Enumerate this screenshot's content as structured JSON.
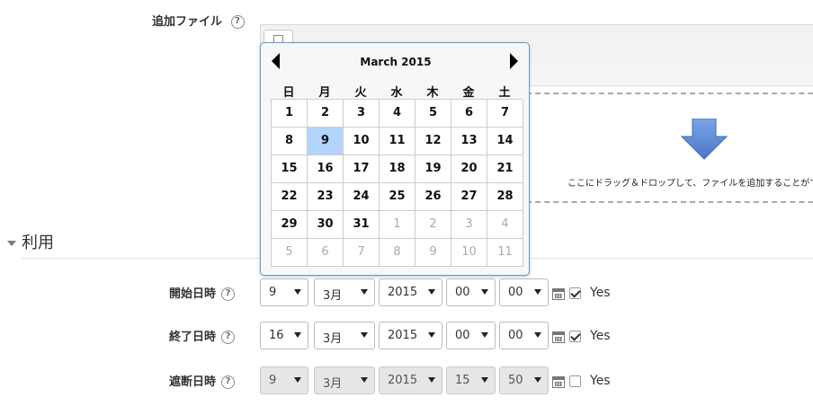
{
  "attachments": {
    "label": "追加ファイル",
    "help": "?"
  },
  "dropzone": {
    "text": "ここにドラッグ＆ドロップして、ファイルを追加することができ"
  },
  "availability": {
    "section_title": "利用"
  },
  "rows": [
    {
      "label": "開始日時",
      "help": "?",
      "day": "9",
      "month": "3月",
      "year": "2015",
      "hour": "00",
      "minute": "00",
      "enabled": true,
      "disabled": false,
      "yes_label": "Yes"
    },
    {
      "label": "終了日時",
      "help": "?",
      "day": "16",
      "month": "3月",
      "year": "2015",
      "hour": "00",
      "minute": "00",
      "enabled": true,
      "disabled": false,
      "yes_label": "Yes"
    },
    {
      "label": "遮断日時",
      "help": "?",
      "day": "9",
      "month": "3月",
      "year": "2015",
      "hour": "15",
      "minute": "50",
      "enabled": false,
      "disabled": true,
      "yes_label": "Yes"
    }
  ],
  "calendar": {
    "title": "March 2015",
    "weekdays": [
      "日",
      "月",
      "火",
      "水",
      "木",
      "金",
      "土"
    ],
    "selected_day": "9",
    "weeks": [
      [
        {
          "d": "1",
          "cur": true
        },
        {
          "d": "2",
          "cur": true
        },
        {
          "d": "3",
          "cur": true
        },
        {
          "d": "4",
          "cur": true
        },
        {
          "d": "5",
          "cur": true
        },
        {
          "d": "6",
          "cur": true
        },
        {
          "d": "7",
          "cur": true
        }
      ],
      [
        {
          "d": "8",
          "cur": true
        },
        {
          "d": "9",
          "cur": true
        },
        {
          "d": "10",
          "cur": true
        },
        {
          "d": "11",
          "cur": true
        },
        {
          "d": "12",
          "cur": true
        },
        {
          "d": "13",
          "cur": true
        },
        {
          "d": "14",
          "cur": true
        }
      ],
      [
        {
          "d": "15",
          "cur": true
        },
        {
          "d": "16",
          "cur": true
        },
        {
          "d": "17",
          "cur": true
        },
        {
          "d": "18",
          "cur": true
        },
        {
          "d": "19",
          "cur": true
        },
        {
          "d": "20",
          "cur": true
        },
        {
          "d": "21",
          "cur": true
        }
      ],
      [
        {
          "d": "22",
          "cur": true
        },
        {
          "d": "23",
          "cur": true
        },
        {
          "d": "24",
          "cur": true
        },
        {
          "d": "25",
          "cur": true
        },
        {
          "d": "26",
          "cur": true
        },
        {
          "d": "27",
          "cur": true
        },
        {
          "d": "28",
          "cur": true
        }
      ],
      [
        {
          "d": "29",
          "cur": true
        },
        {
          "d": "30",
          "cur": true
        },
        {
          "d": "31",
          "cur": true
        },
        {
          "d": "1",
          "cur": false
        },
        {
          "d": "2",
          "cur": false
        },
        {
          "d": "3",
          "cur": false
        },
        {
          "d": "4",
          "cur": false
        }
      ],
      [
        {
          "d": "5",
          "cur": false
        },
        {
          "d": "6",
          "cur": false
        },
        {
          "d": "7",
          "cur": false
        },
        {
          "d": "8",
          "cur": false
        },
        {
          "d": "9",
          "cur": false
        },
        {
          "d": "10",
          "cur": false
        },
        {
          "d": "11",
          "cur": false
        }
      ]
    ]
  },
  "colors": {
    "calendar_border": "#6b97d6",
    "selected_day": "#b3d4fc",
    "drop_arrow": "#5b8bd4"
  },
  "icons": [
    "help-icon",
    "file-icon",
    "download-arrow-icon",
    "calendar-icon",
    "checkbox-icon",
    "prev-month-icon",
    "next-month-icon",
    "collapse-triangle-icon"
  ]
}
